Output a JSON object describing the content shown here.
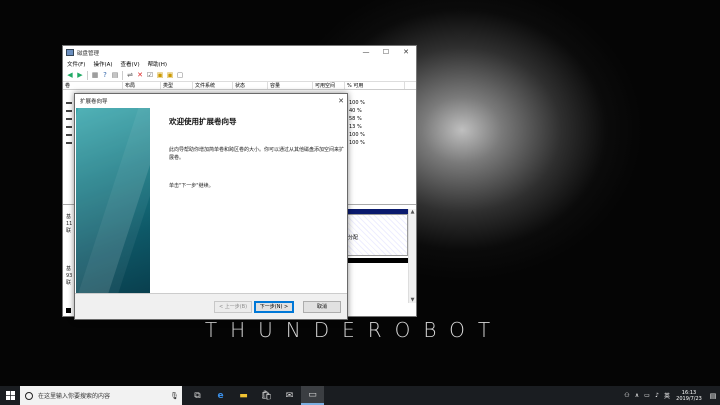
{
  "brand_text": "THUNDEROBOT",
  "disk_mgmt": {
    "title": "磁盘管理",
    "menu": [
      "文件(F)",
      "操作(A)",
      "查看(V)",
      "帮助(H)"
    ],
    "columns": [
      "卷",
      "布局",
      "类型",
      "文件系统",
      "状态",
      "容量",
      "可用空间",
      "% 可用"
    ],
    "pct_values": [
      "100 %",
      "40 %",
      "58 %",
      "13 %",
      "100 %",
      "100 %"
    ],
    "disk0_lines": [
      "基",
      "11",
      "联"
    ],
    "disk1_lines": [
      "基",
      "93",
      "联"
    ],
    "partition_label": "未分配",
    "partition_fragment": "分配"
  },
  "wizard": {
    "title": "扩展卷向导",
    "heading": "欢迎使用扩展卷向导",
    "paragraph": "此向导帮助你增加简单卷和跨区卷的大小。你可以通过从其他磁盘添加空间来扩展卷。",
    "instruction": "单击\"下一步\"继续。",
    "back_label": "< 上一步(B)",
    "next_label": "下一步(N) >",
    "cancel_label": "取消"
  },
  "taskbar": {
    "search_placeholder": "在这里输入你要搜索的内容",
    "time": "16:13",
    "date": "2019/7/23"
  }
}
